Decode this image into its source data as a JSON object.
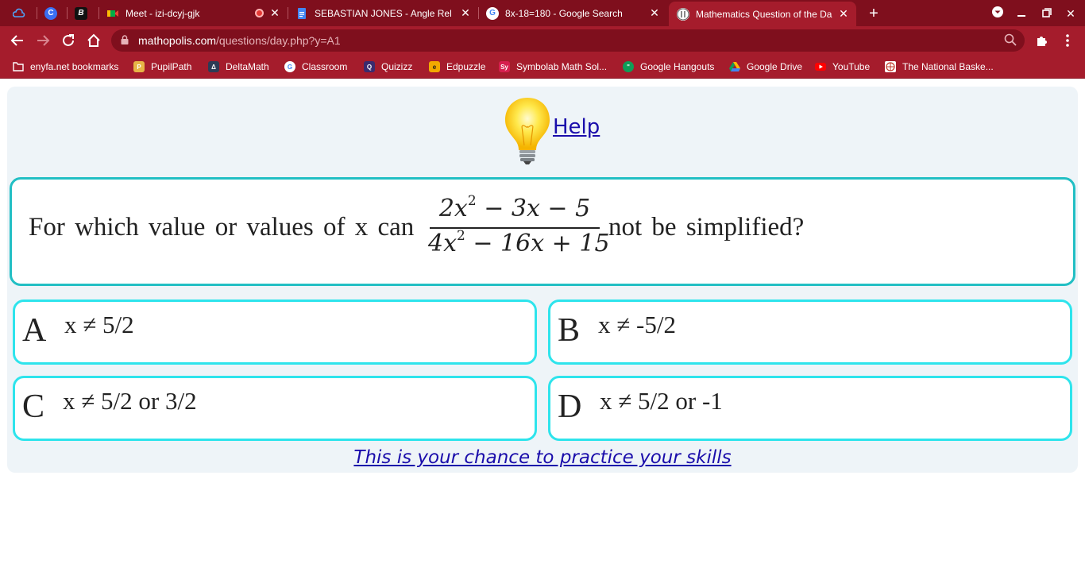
{
  "tabs": [
    {
      "title": "",
      "icon": "cloud-icon",
      "active": false
    },
    {
      "title": "",
      "icon": "c-circle-icon",
      "active": false
    },
    {
      "title": "",
      "icon": "bold-b-icon",
      "active": false
    },
    {
      "title": "Meet - izi-dcyj-gjk",
      "icon": "google-meet-icon",
      "active": false,
      "recording": true
    },
    {
      "title": "SEBASTIAN JONES - Angle Rel R",
      "icon": "google-docs-icon",
      "active": false
    },
    {
      "title": "8x-18=180 - Google Search",
      "icon": "google-icon",
      "active": false
    },
    {
      "title": "Mathematics Question of the Da",
      "icon": "mathopolis-icon",
      "active": true
    }
  ],
  "address_bar": {
    "domain": "mathopolis.com",
    "path": "/questions/day.php?y=A1"
  },
  "bookmarks": [
    {
      "label": "enyfa.net bookmarks",
      "icon": "folder-icon"
    },
    {
      "label": "PupilPath",
      "icon": "pupilpath-icon"
    },
    {
      "label": "DeltaMath",
      "icon": "deltamath-icon"
    },
    {
      "label": "Classroom",
      "icon": "google-icon"
    },
    {
      "label": "Quizizz",
      "icon": "quizizz-icon"
    },
    {
      "label": "Edpuzzle",
      "icon": "edpuzzle-icon"
    },
    {
      "label": "Symbolab Math Sol...",
      "icon": "symbolab-icon"
    },
    {
      "label": "Google Hangouts",
      "icon": "hangouts-icon"
    },
    {
      "label": "Google Drive",
      "icon": "drive-icon"
    },
    {
      "label": "YouTube",
      "icon": "youtube-icon"
    },
    {
      "label": "The National Baske...",
      "icon": "nba-icon"
    }
  ],
  "help": {
    "label": "Help",
    "icon": "lightbulb-icon"
  },
  "question": {
    "prefix": "For which value or values of x can",
    "numerator": "2x² − 3x − 5",
    "denominator": "4x² − 16x + 15",
    "suffix": "not be simplified?"
  },
  "choices": [
    {
      "letter": "A",
      "text": "x ≠ 5/2"
    },
    {
      "letter": "B",
      "text": "x ≠ -5/2"
    },
    {
      "letter": "C",
      "text": "x ≠ 5/2 or 3/2"
    },
    {
      "letter": "D",
      "text": "x ≠ 5/2 or -1"
    }
  ],
  "practice_link": "This is your chance to practice your skills",
  "colors": {
    "chrome_dark": "#7f0f1d",
    "chrome": "#a51c2c",
    "panel_bg": "#eef4f8",
    "question_border": "#22bfc4",
    "choice_border": "#2ee4ec",
    "link": "#1a0dab"
  }
}
